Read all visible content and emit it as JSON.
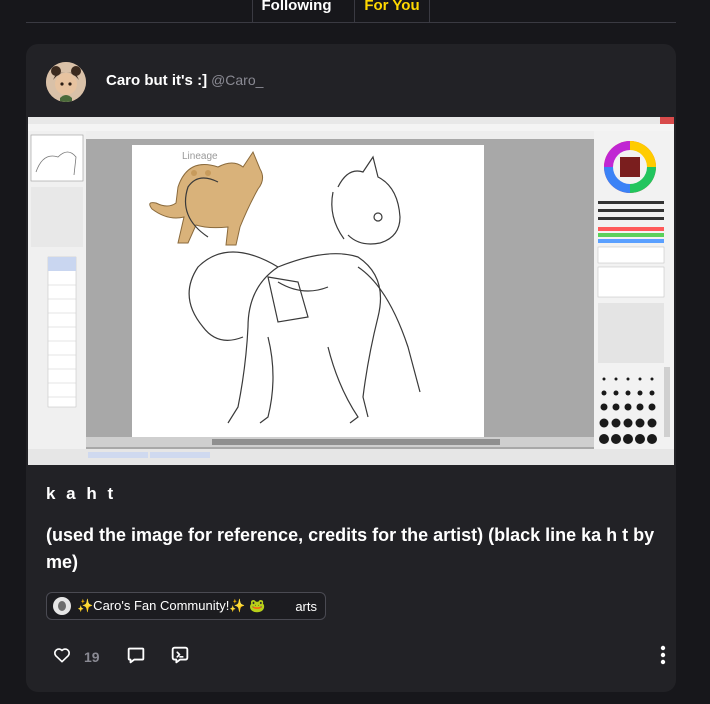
{
  "tabs": [
    {
      "label": "Following",
      "active": false
    },
    {
      "label": "For You",
      "active": true
    }
  ],
  "post": {
    "author_name": "Caro but it's :]",
    "author_handle": "@Caro_",
    "title": "k a h t",
    "body": "(used the image for reference, credits for the artist) (black line ka h t by me)",
    "community": {
      "name": "✨Caro's Fan Community!✨ 🐸",
      "channel": "arts"
    },
    "like_count": "19"
  },
  "icons": {
    "like": "heart-icon",
    "comment": "comment-bubble-icon",
    "share": "repost-icon",
    "more": "more-vertical-icon"
  },
  "colors": {
    "background": "#17171b",
    "card": "#222226",
    "active_tab": "#ffd800",
    "muted": "#8a8a93"
  }
}
